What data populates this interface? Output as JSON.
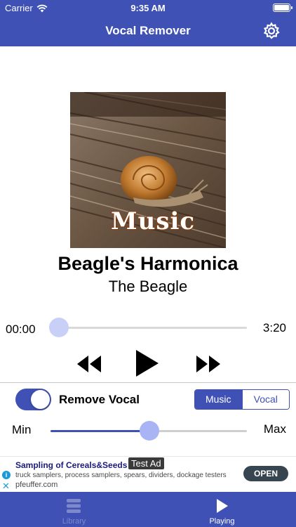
{
  "status_bar": {
    "carrier": "Carrier",
    "time": "9:35 AM"
  },
  "header": {
    "title": "Vocal Remover",
    "settings_icon": "gear-icon"
  },
  "album_art": {
    "overlay_text": "Music"
  },
  "track": {
    "title": "Beagle's Harmonica",
    "artist": "The Beagle"
  },
  "progress": {
    "current": "00:00",
    "total": "3:20",
    "fraction": 0.0
  },
  "controls": {
    "rewind_icon": "rewind-icon",
    "play_icon": "play-icon",
    "forward_icon": "fast-forward-icon"
  },
  "remove_vocal": {
    "label": "Remove Vocal",
    "enabled": true
  },
  "mode_segment": {
    "options": [
      "Music",
      "Vocal"
    ],
    "selected": "Music"
  },
  "level_slider": {
    "min_label": "Min",
    "max_label": "Max",
    "fraction": 0.5
  },
  "ad": {
    "badge": "Test Ad",
    "title": "Sampling of Cereals&Seeds",
    "description": "truck samplers, process samplers, spears, dividers, dockage testers",
    "url": "pfeuffer.com",
    "cta": "OPEN"
  },
  "tabs": [
    {
      "label": "Library",
      "icon": "library-icon",
      "active": false
    },
    {
      "label": "Playing",
      "icon": "play-icon",
      "active": true
    }
  ],
  "colors": {
    "primary": "#3f51b5",
    "thumb": "#c9d0f7",
    "inactive_tab": "#7e89c9"
  }
}
